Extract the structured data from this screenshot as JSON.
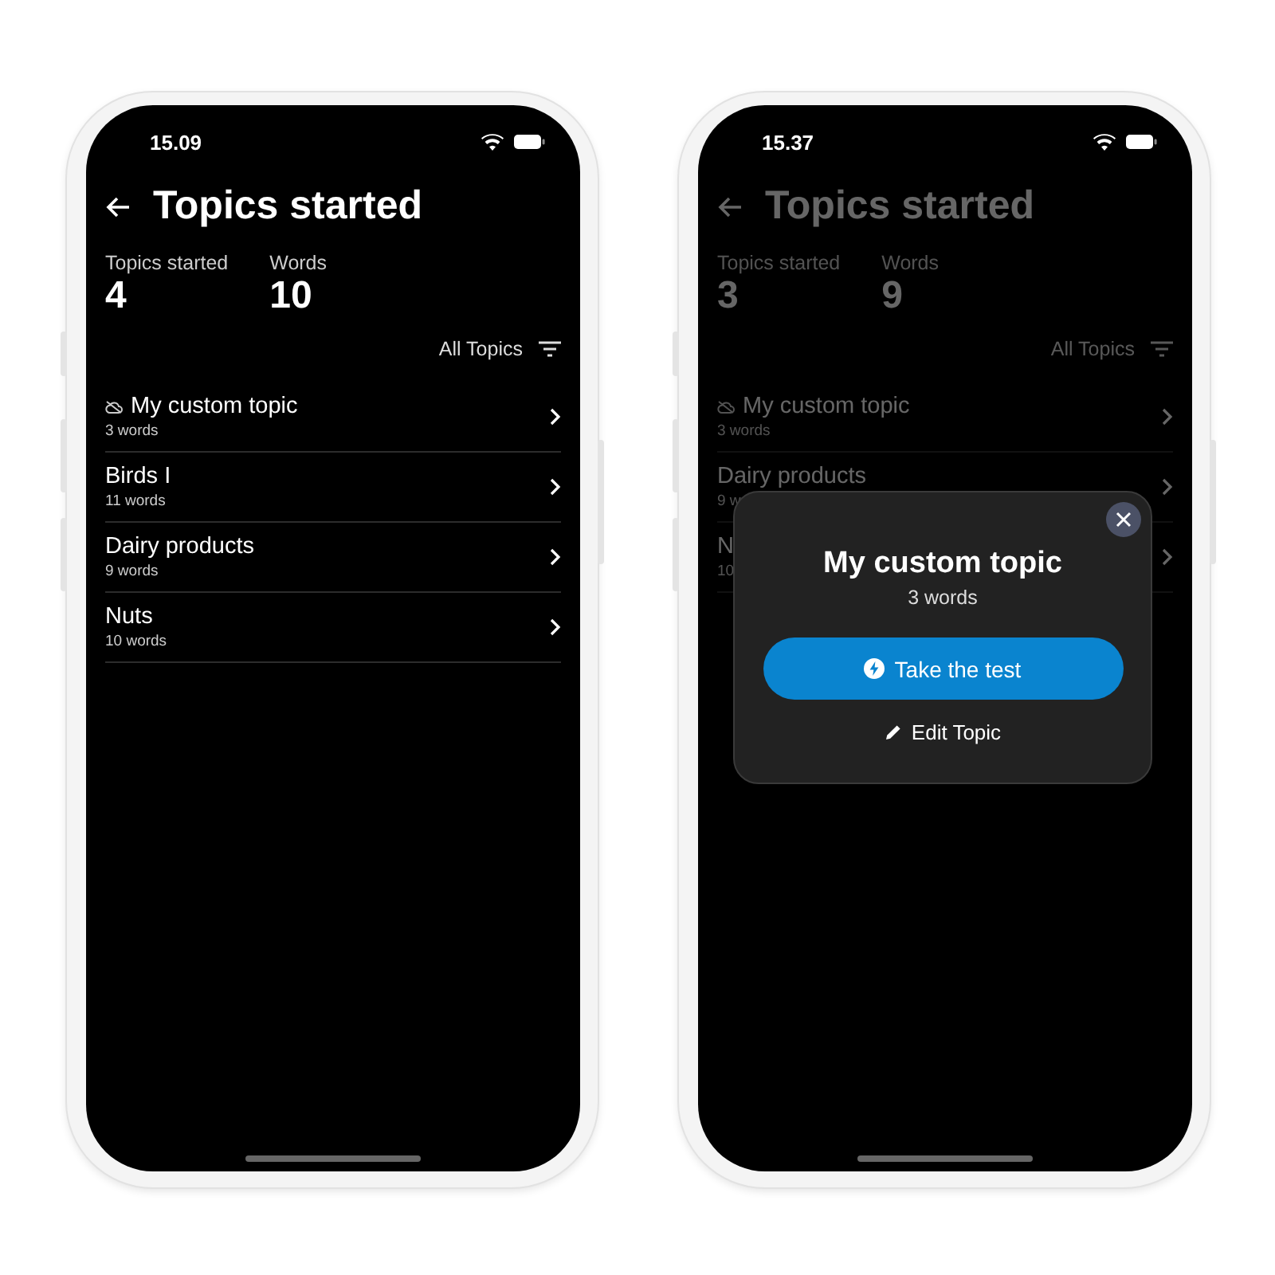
{
  "phones": [
    {
      "time": "15.09",
      "dimmed": false,
      "title": "Topics started",
      "stats": [
        {
          "label": "Topics started",
          "value": "4"
        },
        {
          "label": "Words",
          "value": "10"
        }
      ],
      "filter": "All Topics",
      "topics": [
        {
          "kind": "custom",
          "name": "My custom topic",
          "count": "3 words"
        },
        {
          "kind": "plain",
          "name": "Birds I",
          "count": "11 words"
        },
        {
          "kind": "plain",
          "name": "Dairy products",
          "count": "9 words"
        },
        {
          "kind": "plain",
          "name": "Nuts",
          "count": "10 words"
        }
      ]
    },
    {
      "time": "15.37",
      "dimmed": true,
      "title": "Topics started",
      "stats": [
        {
          "label": "Topics started",
          "value": "3"
        },
        {
          "label": "Words",
          "value": "9"
        }
      ],
      "filter": "All Topics",
      "topics": [
        {
          "kind": "custom",
          "name": "My custom topic",
          "count": "3 words"
        },
        {
          "kind": "plain",
          "name": "Dairy products",
          "count": "9 w"
        },
        {
          "kind": "plain",
          "name": "N",
          "count": "10"
        }
      ],
      "popup": {
        "title": "My custom topic",
        "subtitle": "3 words",
        "primary": "Take the test",
        "secondary": "Edit Topic"
      }
    }
  ]
}
